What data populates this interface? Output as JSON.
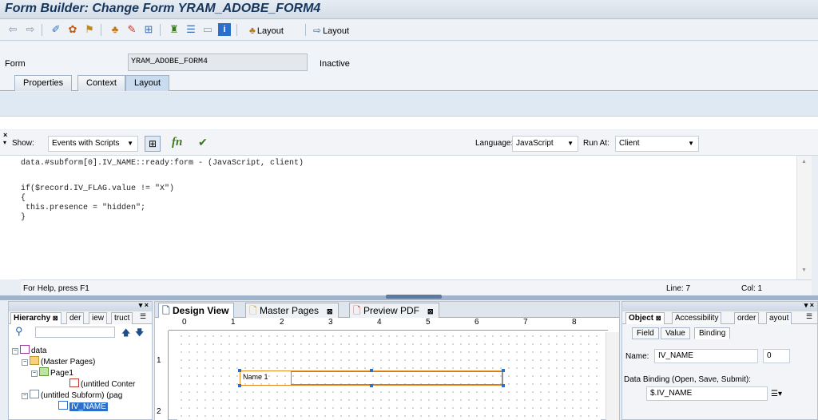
{
  "title": "Form Builder: Change Form YRAM_ADOBE_FORM4",
  "toolbar": {
    "layout_btn1": "Layout",
    "layout_btn2": "Layout"
  },
  "form": {
    "label": "Form",
    "value": "YRAM_ADOBE_FORM4",
    "status": "Inactive"
  },
  "tabs": [
    "Properties",
    "Context",
    "Layout"
  ],
  "script": {
    "show_label": "Show:",
    "show_value": "Events with Scripts",
    "language_label": "Language:",
    "language_value": "JavaScript",
    "run_label": "Run At:",
    "run_value": "Client",
    "code": [
      "data.#subform[0].IV_NAME::ready:form - (JavaScript, client)",
      "",
      "",
      "if($record.IV_FLAG.value != \"X\")",
      "{",
      " this.presence = \"hidden\";",
      "}"
    ],
    "help_text": "For Help, press F1",
    "line": "Line: 7",
    "col": "Col: 1"
  },
  "hierarchy": {
    "tabs": [
      "Hierarchy",
      "der",
      "iew",
      "truct"
    ],
    "nodes": [
      {
        "label": "data"
      },
      {
        "label": "(Master Pages)"
      },
      {
        "label": "Page1"
      },
      {
        "label": "(untitled Conter"
      },
      {
        "label": "(untitled Subform) (pag"
      },
      {
        "label": "IV_NAME"
      }
    ]
  },
  "design": {
    "tabs": [
      "Design View",
      "Master Pages",
      "Preview PDF"
    ],
    "ruler_h": [
      "0",
      "1",
      "2",
      "3",
      "4",
      "5",
      "6",
      "7",
      "8"
    ],
    "ruler_v": [
      "1",
      "2"
    ],
    "field_label": "Name 1"
  },
  "object": {
    "tabs": [
      "Object",
      "Accessibility",
      "order",
      "ayout"
    ],
    "subtabs": [
      "Field",
      "Value",
      "Binding"
    ],
    "name_label": "Name:",
    "name_value": "IV_NAME",
    "name_index": "0",
    "binding_label": "Data Binding (Open, Save, Submit):",
    "binding_value": "$.IV_NAME"
  }
}
